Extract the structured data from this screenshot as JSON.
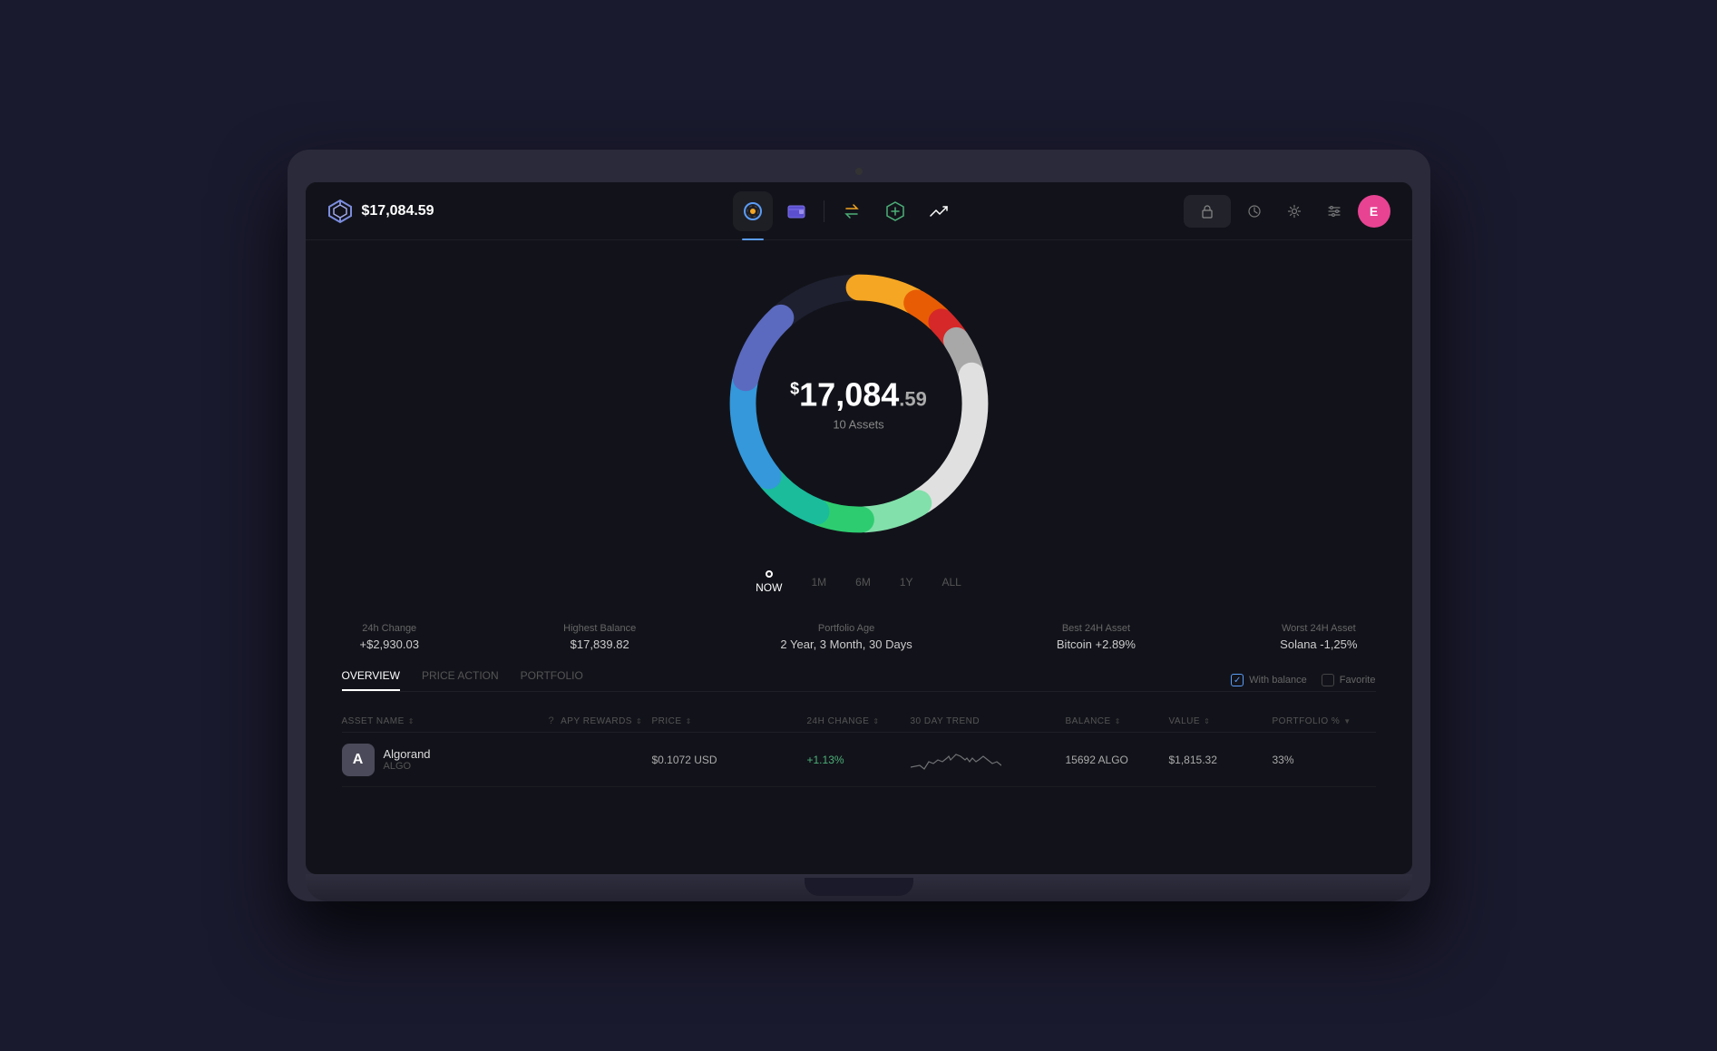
{
  "header": {
    "portfolio_value": "$17,084.59",
    "logo_text": "logo"
  },
  "nav": {
    "items": [
      {
        "id": "dashboard",
        "label": "Dashboard",
        "active": true
      },
      {
        "id": "wallet",
        "label": "Wallet",
        "active": false
      },
      {
        "id": "swap",
        "label": "Swap",
        "active": false
      },
      {
        "id": "add",
        "label": "Add",
        "active": false
      },
      {
        "id": "trending",
        "label": "Trending",
        "active": false
      }
    ],
    "right": {
      "lock_icon": "🔒",
      "history_icon": "↺",
      "settings1_icon": "⚙",
      "settings2_icon": "≡",
      "avatar": "E"
    }
  },
  "chart": {
    "center_value_prefix": "$",
    "center_value_main": "17,084",
    "center_value_cents": ".59",
    "subtitle": "10 Assets",
    "segments": [
      {
        "color": "#f5a623",
        "pct": 8
      },
      {
        "color": "#e85d04",
        "pct": 4
      },
      {
        "color": "#d62828",
        "pct": 3
      },
      {
        "color": "#a8a8a8",
        "pct": 5
      },
      {
        "color": "#e0e0e0",
        "pct": 20
      },
      {
        "color": "#82e0aa",
        "pct": 8
      },
      {
        "color": "#2ecc71",
        "pct": 6
      },
      {
        "color": "#1abc9c",
        "pct": 8
      },
      {
        "color": "#3498db",
        "pct": 14
      },
      {
        "color": "#5b6abf",
        "pct": 10
      }
    ]
  },
  "time_selector": {
    "buttons": [
      "NOW",
      "1M",
      "6M",
      "1Y",
      "ALL"
    ],
    "active": "NOW"
  },
  "stats": [
    {
      "label": "24h Change",
      "value": "+$2,930.03"
    },
    {
      "label": "Highest Balance",
      "value": "$17,839.82"
    },
    {
      "label": "Portfolio Age",
      "value": "2 Year, 3 Month, 30 Days"
    },
    {
      "label": "Best 24H Asset",
      "value": "Bitcoin +2.89%"
    },
    {
      "label": "Worst 24H Asset",
      "value": "Solana -1,25%"
    }
  ],
  "tabs": {
    "items": [
      {
        "id": "overview",
        "label": "OVERVIEW",
        "active": true
      },
      {
        "id": "price-action",
        "label": "PRICE ACTION",
        "active": false
      },
      {
        "id": "portfolio",
        "label": "PORTFOLIO",
        "active": false
      }
    ],
    "filters": [
      {
        "id": "with-balance",
        "label": "With balance",
        "checked": true
      },
      {
        "id": "favorite",
        "label": "Favorite",
        "checked": false
      }
    ]
  },
  "table": {
    "headers": [
      {
        "id": "asset-name",
        "label": "ASSET NAME",
        "sortable": true
      },
      {
        "id": "apy-rewards",
        "label": "APY REWARDS",
        "sortable": true,
        "info": true
      },
      {
        "id": "price",
        "label": "PRICE",
        "sortable": true
      },
      {
        "id": "24h-change",
        "label": "24H CHANGE",
        "sortable": true
      },
      {
        "id": "30day-trend",
        "label": "30 DAY TREND",
        "sortable": false
      },
      {
        "id": "balance",
        "label": "BALANCE",
        "sortable": true
      },
      {
        "id": "value",
        "label": "VALUE",
        "sortable": true
      },
      {
        "id": "portfolio-pct",
        "label": "PORTFOLIO %",
        "sortable": true
      }
    ],
    "rows": [
      {
        "icon": "A",
        "icon_bg": "#8b8b9a",
        "name": "Algorand",
        "ticker": "ALGO",
        "apy": "",
        "price": "$0.1072 USD",
        "change": "+1.13%",
        "change_positive": true,
        "balance": "15692 ALGO",
        "value": "$1,815.32",
        "portfolio_pct": "33%"
      }
    ]
  }
}
